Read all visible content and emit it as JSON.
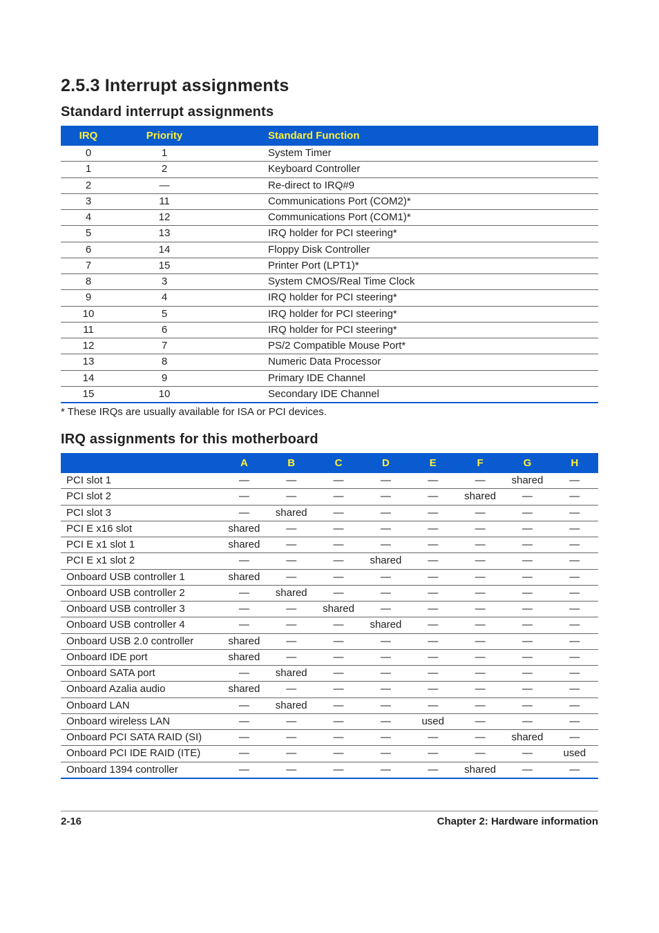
{
  "headings": {
    "section": "2.5.3   Interrupt assignments",
    "sub1": "Standard interrupt assignments",
    "sub2": "IRQ assignments for this motherboard",
    "note": "* These IRQs are usually available for ISA or PCI devices."
  },
  "table1": {
    "headers": {
      "irq": "IRQ",
      "priority": "Priority",
      "func": "Standard Function"
    },
    "rows": [
      {
        "irq": "0",
        "priority": "1",
        "func": "System Timer"
      },
      {
        "irq": "1",
        "priority": "2",
        "func": "Keyboard Controller"
      },
      {
        "irq": "2",
        "priority": "—",
        "func": "Re-direct to IRQ#9"
      },
      {
        "irq": "3",
        "priority": "11",
        "func": "Communications Port (COM2)*"
      },
      {
        "irq": "4",
        "priority": "12",
        "func": "Communications Port (COM1)*"
      },
      {
        "irq": "5",
        "priority": "13",
        "func": "IRQ holder for PCI steering*"
      },
      {
        "irq": "6",
        "priority": "14",
        "func": "Floppy Disk Controller"
      },
      {
        "irq": "7",
        "priority": "15",
        "func": "Printer Port (LPT1)*"
      },
      {
        "irq": "8",
        "priority": "3",
        "func": "System CMOS/Real Time Clock"
      },
      {
        "irq": "9",
        "priority": "4",
        "func": "IRQ holder for PCI steering*"
      },
      {
        "irq": "10",
        "priority": "5",
        "func": "IRQ holder for PCI steering*"
      },
      {
        "irq": "11",
        "priority": "6",
        "func": "IRQ holder for PCI steering*"
      },
      {
        "irq": "12",
        "priority": "7",
        "func": "PS/2 Compatible Mouse Port*"
      },
      {
        "irq": "13",
        "priority": "8",
        "func": "Numeric Data Processor"
      },
      {
        "irq": "14",
        "priority": "9",
        "func": "Primary IDE Channel"
      },
      {
        "irq": "15",
        "priority": "10",
        "func": "Secondary IDE Channel"
      }
    ]
  },
  "table2": {
    "headers": [
      "A",
      "B",
      "C",
      "D",
      "E",
      "F",
      "G",
      "H"
    ],
    "rows": [
      {
        "device": "PCI slot 1",
        "vals": [
          "—",
          "—",
          "—",
          "—",
          "—",
          "—",
          "shared",
          "—"
        ]
      },
      {
        "device": "PCI slot 2",
        "vals": [
          "—",
          "—",
          "—",
          "—",
          "—",
          "shared",
          "—",
          "—"
        ]
      },
      {
        "device": "PCI slot 3",
        "vals": [
          "—",
          "shared",
          "—",
          "—",
          "—",
          "—",
          "—",
          "—"
        ]
      },
      {
        "device": "PCI E x16 slot",
        "vals": [
          "shared",
          "—",
          "—",
          "—",
          "—",
          "—",
          "—",
          "—"
        ]
      },
      {
        "device": "PCI E x1 slot 1",
        "vals": [
          "shared",
          "—",
          "—",
          "—",
          "—",
          "—",
          "—",
          "—"
        ]
      },
      {
        "device": "PCI E x1 slot 2",
        "vals": [
          "—",
          "—",
          "—",
          "shared",
          "—",
          "—",
          "—",
          "—"
        ]
      },
      {
        "device": "Onboard USB controller 1",
        "vals": [
          "shared",
          "—",
          "—",
          "—",
          "—",
          "—",
          "—",
          "—"
        ]
      },
      {
        "device": "Onboard USB controller 2",
        "vals": [
          "—",
          "shared",
          "—",
          "—",
          "—",
          "—",
          "—",
          "—"
        ]
      },
      {
        "device": "Onboard USB controller 3",
        "vals": [
          "—",
          "—",
          "shared",
          "—",
          "—",
          "—",
          "—",
          "—"
        ]
      },
      {
        "device": "Onboard USB controller 4",
        "vals": [
          "—",
          "—",
          "—",
          "shared",
          "—",
          "—",
          "—",
          "—"
        ]
      },
      {
        "device": "Onboard USB 2.0 controller",
        "vals": [
          "shared",
          "—",
          "—",
          "—",
          "—",
          "—",
          "—",
          "—"
        ]
      },
      {
        "device": "Onboard IDE port",
        "vals": [
          "shared",
          "—",
          "—",
          "—",
          "—",
          "—",
          "—",
          "—"
        ]
      },
      {
        "device": "Onboard SATA port",
        "vals": [
          "—",
          "shared",
          "—",
          "—",
          "—",
          "—",
          "—",
          "—"
        ]
      },
      {
        "device": "Onboard Azalia audio",
        "vals": [
          "shared",
          "—",
          "—",
          "—",
          "—",
          "—",
          "—",
          "—"
        ]
      },
      {
        "device": "Onboard LAN",
        "vals": [
          "—",
          "shared",
          "—",
          "—",
          "—",
          "—",
          "—",
          "—"
        ]
      },
      {
        "device": "Onboard wireless LAN",
        "vals": [
          "—",
          "—",
          "—",
          "—",
          "used",
          "—",
          "—",
          "—"
        ]
      },
      {
        "device": "Onboard PCI SATA RAID (SI)",
        "vals": [
          "—",
          "—",
          "—",
          "—",
          "—",
          "—",
          "shared",
          "—"
        ]
      },
      {
        "device": "Onboard PCI IDE RAID (ITE)",
        "vals": [
          "—",
          "—",
          "—",
          "—",
          "—",
          "—",
          "—",
          "used"
        ]
      },
      {
        "device": "Onboard 1394 controller",
        "vals": [
          "—",
          "—",
          "—",
          "—",
          "—",
          "shared",
          "—",
          "—"
        ]
      }
    ]
  },
  "footer": {
    "left": "2-16",
    "right": "Chapter 2: Hardware information"
  }
}
